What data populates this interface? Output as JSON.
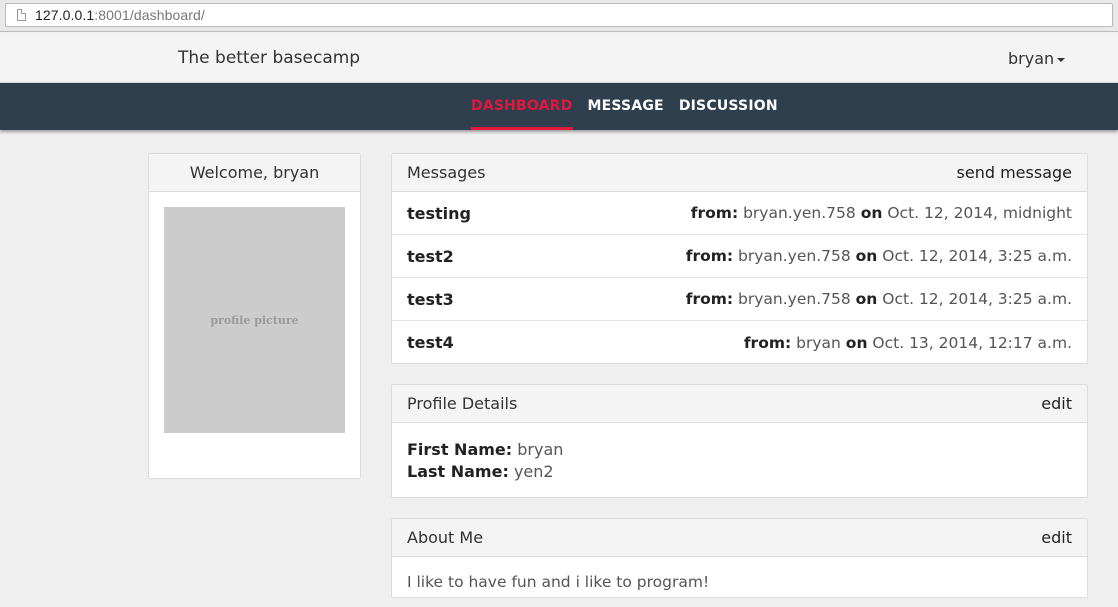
{
  "browser": {
    "url_host": "127.0.0.1",
    "url_rest": ":8001/dashboard/"
  },
  "header": {
    "brand": "The better basecamp",
    "user": "bryan"
  },
  "nav": {
    "items": [
      {
        "label": "DASHBOARD",
        "active": true
      },
      {
        "label": "MESSAGE",
        "active": false
      },
      {
        "label": "DISCUSSION",
        "active": false
      }
    ],
    "active_color": "#e3163e",
    "bar_color": "#2f3f4e"
  },
  "welcome": {
    "title": "Welcome, bryan",
    "picture_label": "profile picture"
  },
  "messages": {
    "title": "Messages",
    "action": "send message",
    "from_label": "from:",
    "on_label": "on",
    "rows": [
      {
        "subject": "testing",
        "from": "bryan.yen.758",
        "date": "Oct. 12, 2014, midnight"
      },
      {
        "subject": "test2",
        "from": "bryan.yen.758",
        "date": "Oct. 12, 2014, 3:25 a.m."
      },
      {
        "subject": "test3",
        "from": "bryan.yen.758",
        "date": "Oct. 12, 2014, 3:25 a.m."
      },
      {
        "subject": "test4",
        "from": "bryan",
        "date": "Oct. 13, 2014, 12:17 a.m."
      }
    ]
  },
  "profile": {
    "title": "Profile Details",
    "action": "edit",
    "first_name_label": "First Name:",
    "first_name": "bryan",
    "last_name_label": "Last Name:",
    "last_name": "yen2"
  },
  "about": {
    "title": "About Me",
    "action": "edit",
    "text": "I like to have fun and i like to program!"
  }
}
